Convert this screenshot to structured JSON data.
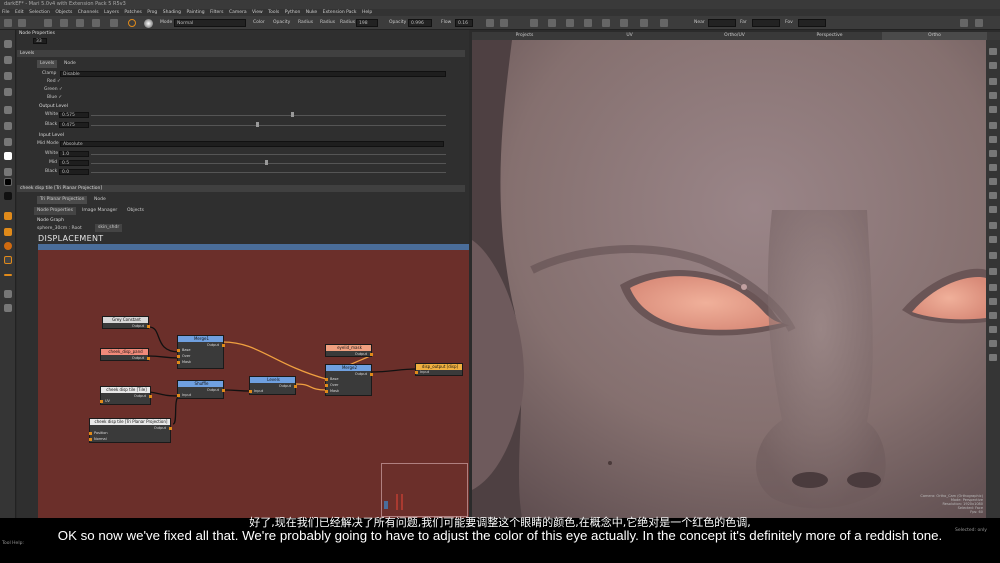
{
  "window": {
    "title": "darkEF* - Mari 5.0v4 with Extension Pack 5 R5v3"
  },
  "menu": [
    "File",
    "Edit",
    "Selection",
    "Objects",
    "Channels",
    "Layers",
    "Patches",
    "Prog",
    "Shading",
    "Painting",
    "Filters",
    "Camera",
    "View",
    "Tools",
    "Python",
    "Nuke",
    "Extension Pack",
    "Help"
  ],
  "toolbar": {
    "mode_label": "Mode",
    "mode_value": "Normal",
    "color_label": "Color",
    "opacity_label": "Opacity",
    "radius_label": "Radius",
    "radius_label2": "Radius",
    "radius_value": "198",
    "opacity_label2": "Opacity",
    "opacity_value": "0.996",
    "flow_label": "Flow",
    "flow_value": "0.16",
    "near_label": "Near",
    "far_label": "Far",
    "fov_label": "Fov"
  },
  "node_properties": {
    "header": "Node Properties",
    "count": "33",
    "levels_header": "Levels",
    "tab_levels": "Levels",
    "tab_node": "Node",
    "clamp_label": "Clamp",
    "clamp_value": "Disable",
    "red": "Red ✓",
    "green": "Green ✓",
    "blue": "Blue ✓",
    "output_level": "Output Level",
    "white_label": "White",
    "white_value": "0.575",
    "black_label": "Black",
    "black_value": "0.475",
    "input_level": "Input Level",
    "midmode_label": "Mid Mode",
    "midmode_value": "Absolute",
    "in_white_label": "White",
    "in_white_value": "1.0",
    "mid_label": "Mid",
    "mid_value": "0.5",
    "in_black_label": "Black",
    "in_black_value": "0.0",
    "second_header": "cheek disp tile [Tri Planar Projection]",
    "tab_triplanar": "Tri Planar Projection",
    "tab_node2": "Node",
    "bottom_tabs": [
      "Node Properties",
      "Image Manager",
      "Objects"
    ]
  },
  "node_graph": {
    "header": "Node Graph",
    "path": "sphere_30cm : Root",
    "tab": "skin_shdr",
    "title": "DISPLACEMENT",
    "nodes": {
      "grey_constant": {
        "title": "Grey Constant",
        "out": "Output"
      },
      "cheek_disp_pand": {
        "title": "cheek_disp_pand",
        "out": "Output"
      },
      "merge1": {
        "title": "Merge1",
        "out": "Output",
        "ports": [
          "Base",
          "Over",
          "Mask"
        ]
      },
      "cheek_tile_file": {
        "title": "cheek disp tile [Tile]",
        "out": "Output",
        "ports": [
          "UV"
        ]
      },
      "shuffle": {
        "title": "Shuffle",
        "out": "Output",
        "ports": [
          "Input"
        ]
      },
      "levels": {
        "title": "Levels",
        "out": "Output",
        "ports": [
          "Input"
        ]
      },
      "cheek_tile_tri": {
        "title": "cheek disp tile [Tri Planar Projection]",
        "out": "Output",
        "ports": [
          "Position",
          "Normal"
        ]
      },
      "eyelid_mask": {
        "title": "eyelid_mask",
        "out": "Output"
      },
      "merge2": {
        "title": "Merge2",
        "out": "Output",
        "ports": [
          "Base",
          "Over",
          "Mask"
        ]
      },
      "disp_output": {
        "title": "disp_output [disp]",
        "ports": [
          "Input"
        ]
      }
    }
  },
  "viewport": {
    "tabs": [
      "Projects",
      "UV",
      "Ortho/UV",
      "Perspective",
      "Ortho"
    ],
    "camera_info": [
      "Camera: Ortho_Cam (Orthographic)",
      "Mode: Perspective",
      "Resolution: 1920x1080",
      "Selected: Face",
      "Fps: 60",
      "Level: Normal",
      "Press Space"
    ]
  },
  "subtitles": {
    "cn": "好了,现在我们已经解决了所有问题,我们可能要调整这个眼睛的颜色,在概念中,它绝对是一个红色的色调,",
    "en": "OK so now we've fixed all that. We're probably going to have to adjust the color of this eye actually. In the concept it's definitely more of a reddish tone."
  },
  "status": {
    "tool_help": "Tool Help:",
    "selected": "Selected: only"
  },
  "colors": {
    "graph_bg": "#6b2f2a",
    "graph_bar": "#4a6d9a",
    "skin": "#8a7476",
    "eye": "#e8a08c"
  }
}
